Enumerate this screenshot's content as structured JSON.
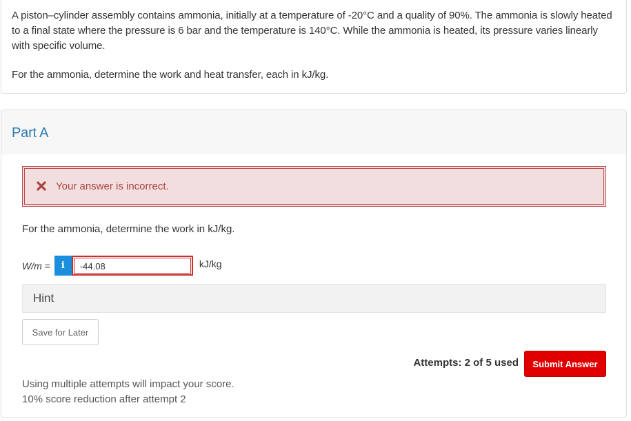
{
  "question": {
    "text": "A piston–cylinder assembly contains ammonia, initially at a temperature of -20°C and a quality of 90%. The ammonia is slowly heated to a final state where the pressure is 6 bar and the temperature is 140°C. While the ammonia is heated, its pressure varies linearly with specific volume.",
    "prompt": "For the ammonia, determine the work and heat transfer, each in kJ/kg."
  },
  "part": {
    "title": "Part A",
    "feedback": {
      "icon": "x-icon",
      "text": "Your answer is incorrect.",
      "color": "#a94442"
    },
    "instruction": "For the ammonia, determine the work in kJ/kg.",
    "answer": {
      "variable": "W/m",
      "equals": " =",
      "info_icon": "info-icon",
      "value": "-44.08",
      "unit": "kJ/kg"
    },
    "hint_label": "Hint",
    "save_label": "Save for Later",
    "attempts_text": "Attempts: 2 of 5 used",
    "submit_label": "Submit Answer",
    "policy_line1": "Using multiple attempts will impact your score.",
    "policy_line2": "10% score reduction after attempt 2"
  },
  "colors": {
    "accent_blue": "#2a7ab0",
    "info_blue": "#1a8fde",
    "error_red": "#c9302c",
    "submit_red": "#e00000"
  }
}
